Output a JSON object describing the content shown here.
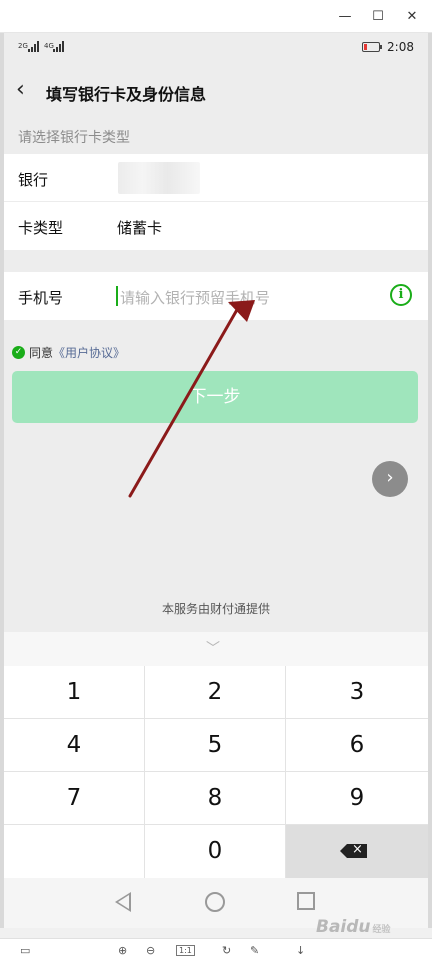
{
  "window": {
    "minimize_icon": "minimize-icon",
    "maximize_icon": "maximize-icon",
    "close_icon": "close-icon"
  },
  "status": {
    "signal_1": "2G",
    "signal_2": "4G",
    "time": "2:08"
  },
  "nav": {
    "title": "填写银行卡及身份信息",
    "back_icon": "chevron-left-icon"
  },
  "section_label": "请选择银行卡类型",
  "bank_form": {
    "bank_label": "银行",
    "card_type_label": "卡类型",
    "card_type_value": "储蓄卡"
  },
  "phone_form": {
    "label": "手机号",
    "placeholder": "请输入银行预留手机号"
  },
  "agreement": {
    "prefix": "同意",
    "link": "《用户协议》"
  },
  "next_button": "下一步",
  "provider": "本服务由财付通提供",
  "keypad": {
    "keys": [
      "1",
      "2",
      "3",
      "4",
      "5",
      "6",
      "7",
      "8",
      "9",
      "0"
    ]
  },
  "watermark": {
    "text": "Baidu",
    "sub": "经验"
  },
  "accent_color": "#1aad19",
  "button_color": "#9fe5bc",
  "annotation_color": "#8b1a1a"
}
